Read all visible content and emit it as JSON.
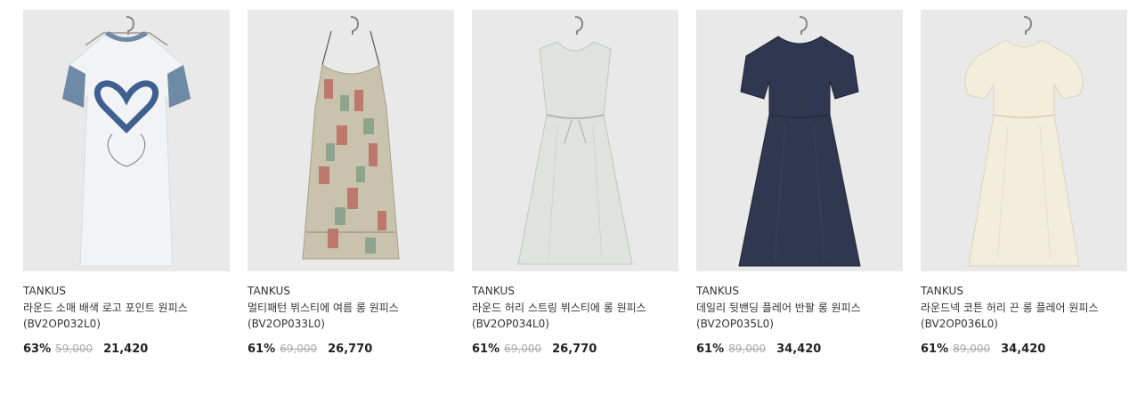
{
  "products": [
    {
      "brand": "TANKUS",
      "title": "라운드 소매 배색 로고 포인트 원피스 (BV2OP032L0)",
      "discount": "63%",
      "original_price": "59,000",
      "sale_price": "21,420",
      "garment_icon": "tshirt-dress-icon",
      "garment_color": "#f1f3f5",
      "accent_color": "#6f8aa6"
    },
    {
      "brand": "TANKUS",
      "title": "멀티패턴 뷔스티에 여름 롱 원피스 (BV2OP033L0)",
      "discount": "61%",
      "original_price": "69,000",
      "sale_price": "26,770",
      "garment_icon": "slip-dress-icon",
      "garment_color": "#c9c3ae",
      "accent_color": "#b8524a"
    },
    {
      "brand": "TANKUS",
      "title": "라운드 허리 스트링 뷔스티에 롱 원피스 (BV2OP034L0)",
      "discount": "61%",
      "original_price": "69,000",
      "sale_price": "26,770",
      "garment_icon": "sleeveless-dress-icon",
      "garment_color": "#dfe2dd",
      "accent_color": "#c8ccc6"
    },
    {
      "brand": "TANKUS",
      "title": "데일리 뒷밴딩 플레어 반팔 롱 원피스 (BV2OP035L0)",
      "discount": "61%",
      "original_price": "89,000",
      "sale_price": "34,420",
      "garment_icon": "short-sleeve-dress-icon",
      "garment_color": "#2f3850",
      "accent_color": "#222a3d"
    },
    {
      "brand": "TANKUS",
      "title": "라운드넥 코튼 허리 끈 롱 플레어 원피스 (BV2OP036L0)",
      "discount": "61%",
      "original_price": "89,000",
      "sale_price": "34,420",
      "garment_icon": "puff-sleeve-dress-icon",
      "garment_color": "#f3eddc",
      "accent_color": "#e6dfc9"
    }
  ]
}
